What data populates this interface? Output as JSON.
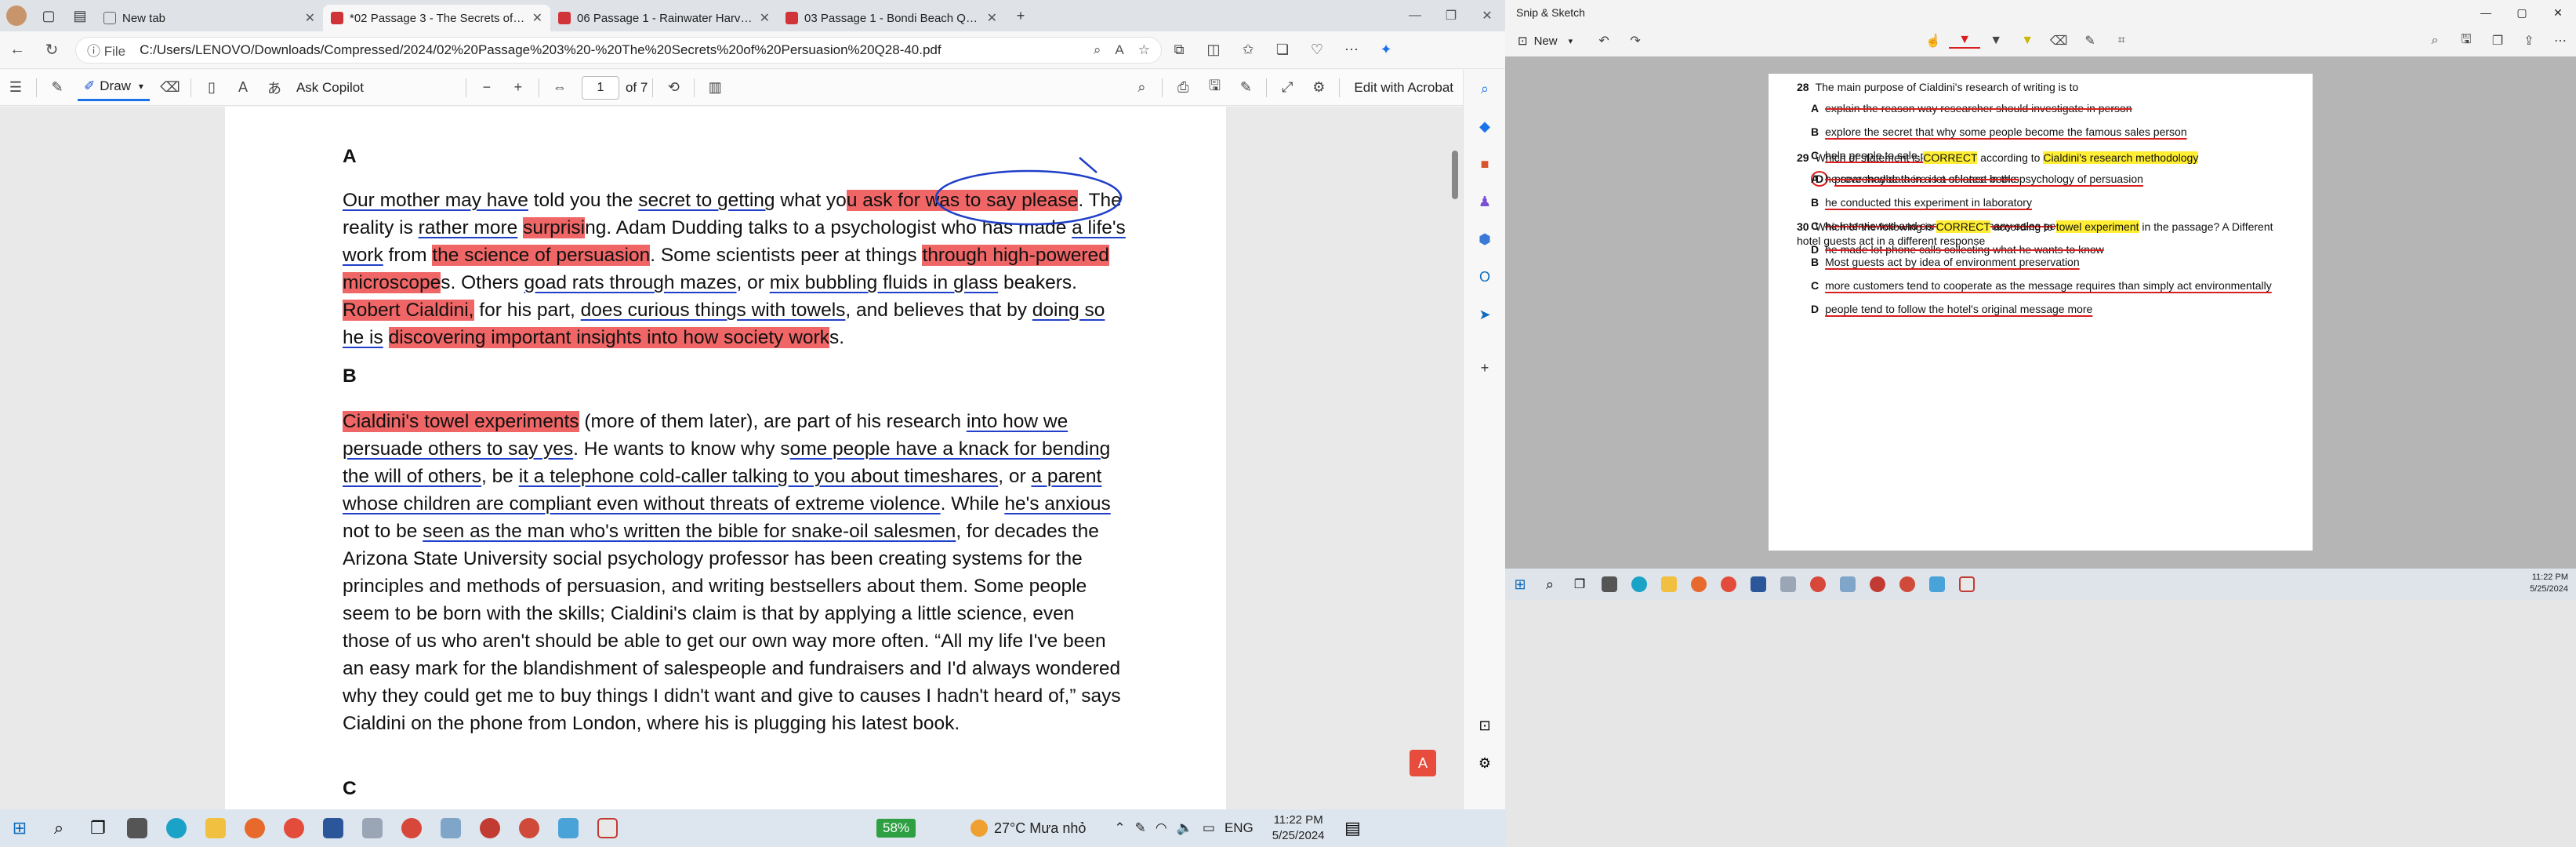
{
  "browser": {
    "tabs": [
      {
        "title": "New tab",
        "type": "page"
      },
      {
        "title": "*02 Passage 3 - The Secrets of Persuasion",
        "type": "pdf"
      },
      {
        "title": "06 Passage 1 - Rainwater Harvesting",
        "type": "pdf"
      },
      {
        "title": "03 Passage 1 - Bondi Beach Q1-13",
        "type": "pdf"
      }
    ],
    "new_tab_symbol": "+",
    "scheme": "File",
    "url": "C:/Users/LENOVO/Downloads/Compressed/2024/02%20Passage%203%20-%20The%20Secrets%20of%20Persuasion%20Q28-40.pdf"
  },
  "pdf_toolbar": {
    "draw_label": "Draw",
    "ask_copilot": "Ask Copilot",
    "page_current": "1",
    "page_total": "of 7",
    "edit_acrobat": "Edit with Acrobat"
  },
  "document": {
    "section_a": "A",
    "para_a": [
      {
        "t": "Our mother may have",
        "s": "ul"
      },
      {
        "t": " told you the ",
        "s": ""
      },
      {
        "t": "secret to getting",
        "s": "ul"
      },
      {
        "t": " what yo",
        "s": ""
      },
      {
        "t": "u ask for was to say please",
        "s": "hl"
      },
      {
        "t": ". The reality is ",
        "s": ""
      },
      {
        "t": "rather more",
        "s": "ul"
      },
      {
        "t": " ",
        "s": ""
      },
      {
        "t": "surprisi",
        "s": "hl"
      },
      {
        "t": "ng. Adam Dudding talks to a psychologist who has made ",
        "s": ""
      },
      {
        "t": "a life's work",
        "s": "ul"
      },
      {
        "t": " from ",
        "s": ""
      },
      {
        "t": "the science of persuasion",
        "s": "hl"
      },
      {
        "t": ". Some scientists peer at things ",
        "s": ""
      },
      {
        "t": "through high-powered microscope",
        "s": "hl"
      },
      {
        "t": "s. Others ",
        "s": ""
      },
      {
        "t": "goad rats through mazes",
        "s": "ul"
      },
      {
        "t": ", or ",
        "s": ""
      },
      {
        "t": "mix bubbling fluids in glass",
        "s": "ul"
      },
      {
        "t": " beakers. ",
        "s": ""
      },
      {
        "t": "Robert Cialdini,",
        "s": "hl"
      },
      {
        "t": " for his part, ",
        "s": ""
      },
      {
        "t": "does curious things with towels",
        "s": "ul"
      },
      {
        "t": ", and believes that by ",
        "s": ""
      },
      {
        "t": "doing so he is",
        "s": "ul"
      },
      {
        "t": " ",
        "s": ""
      },
      {
        "t": "discovering important insights into how society work",
        "s": "hl"
      },
      {
        "t": "s.",
        "s": ""
      }
    ],
    "section_b": "B",
    "para_b": [
      {
        "t": "Cialdini's towel experiments",
        "s": "hl"
      },
      {
        "t": " (more of them later), are part of his research ",
        "s": ""
      },
      {
        "t": "into how we persuade others to say yes",
        "s": "ul"
      },
      {
        "t": ". He wants to know why s",
        "s": ""
      },
      {
        "t": "ome people have a knack for bending the will of others",
        "s": "ul"
      },
      {
        "t": ", be ",
        "s": ""
      },
      {
        "t": "it a telephone cold-caller talking to you about timeshares",
        "s": "ul"
      },
      {
        "t": ", or ",
        "s": ""
      },
      {
        "t": "a parent whose children are compliant even without threats of extreme violence",
        "s": "ul"
      },
      {
        "t": ". While ",
        "s": ""
      },
      {
        "t": "he's anxious",
        "s": "ul"
      },
      {
        "t": " not to be ",
        "s": ""
      },
      {
        "t": "seen as the man who's written the bible for snake-oil salesmen",
        "s": "ul"
      },
      {
        "t": ", for decades the Arizona State University social psychology professor has been creating systems for the principles and methods of persuasion, and writing bestsellers about them. Some people seem to be born with the skills; Cialdini's claim is that by applying a little science, even those of us who aren't should be able to get our own way more often. “All my life I've been an easy mark for the blandishment of salespeople and fundraisers and I'd always wondered why they could get me to buy things I didn't want and give to causes I hadn't heard of,” says Cialdini on the phone from London, where his is plugging his latest book.",
        "s": ""
      }
    ],
    "section_c": "C"
  },
  "taskbar": {
    "battery": "58%",
    "temperature": "27°C",
    "weather_text": "Mưa nhỏ",
    "language": "ENG",
    "time": "11:22 PM",
    "date": "5/25/2024"
  },
  "snip": {
    "app_title": "Snip & Sketch",
    "new_label": "New",
    "shot_time": "11:22 PM",
    "shot_date": "5/25/2024",
    "questions": [
      {
        "num": "28",
        "stem": "The main purpose of Cialdini's research of writing is to",
        "options": [
          {
            "letter": "A",
            "text": "explain the reason way researcher should investigate in person",
            "mark": "strike"
          },
          {
            "letter": "B",
            "text": "explore the secret that why some people become the famous sales person",
            "mark": "ul"
          },
          {
            "letter": "C",
            "text": "help people to sale products",
            "mark": "ul"
          },
          {
            "letter": "D",
            "text": "prove maybe there is a science in the psychology of persuasion",
            "mark": "circle"
          }
        ]
      },
      {
        "num": "29",
        "stem_parts": [
          {
            "t": "Which of statement is ",
            "s": ""
          },
          {
            "t": "CORRECT",
            "s": "hy"
          },
          {
            "t": " according to ",
            "s": ""
          },
          {
            "t": "Cialdini's research methodology",
            "s": "hy"
          }
        ],
        "options": [
          {
            "letter": "A",
            "text": "he searched data in a lot of latest books",
            "mark": "strike"
          },
          {
            "letter": "B",
            "text": "he conducted this experiment in laboratory",
            "mark": "ul"
          },
          {
            "letter": "C",
            "text": "he interviewed and contract with many sales people",
            "mark": "strike"
          },
          {
            "letter": "D",
            "text": "he made lot phone calls collecting what he wants to know",
            "mark": "strike"
          }
        ]
      },
      {
        "num": "30",
        "stem_parts": [
          {
            "t": "Which of the following is ",
            "s": ""
          },
          {
            "t": "CORRECT",
            "s": "hy"
          },
          {
            "t": " according to ",
            "s": ""
          },
          {
            "t": "towel experiment",
            "s": "hy"
          },
          {
            "t": " in the passage? A Different hotel guests act in a different response",
            "s": ""
          }
        ],
        "options": [
          {
            "letter": "B",
            "text": "Most guests act by idea of environment preservation",
            "mark": "ul"
          },
          {
            "letter": "C",
            "text": "more customers tend to cooperate as the message requires than simply act environmentally",
            "mark": "ul"
          },
          {
            "letter": "D",
            "text": "people tend to follow the hotel's original message more",
            "mark": "ul"
          }
        ]
      }
    ]
  }
}
